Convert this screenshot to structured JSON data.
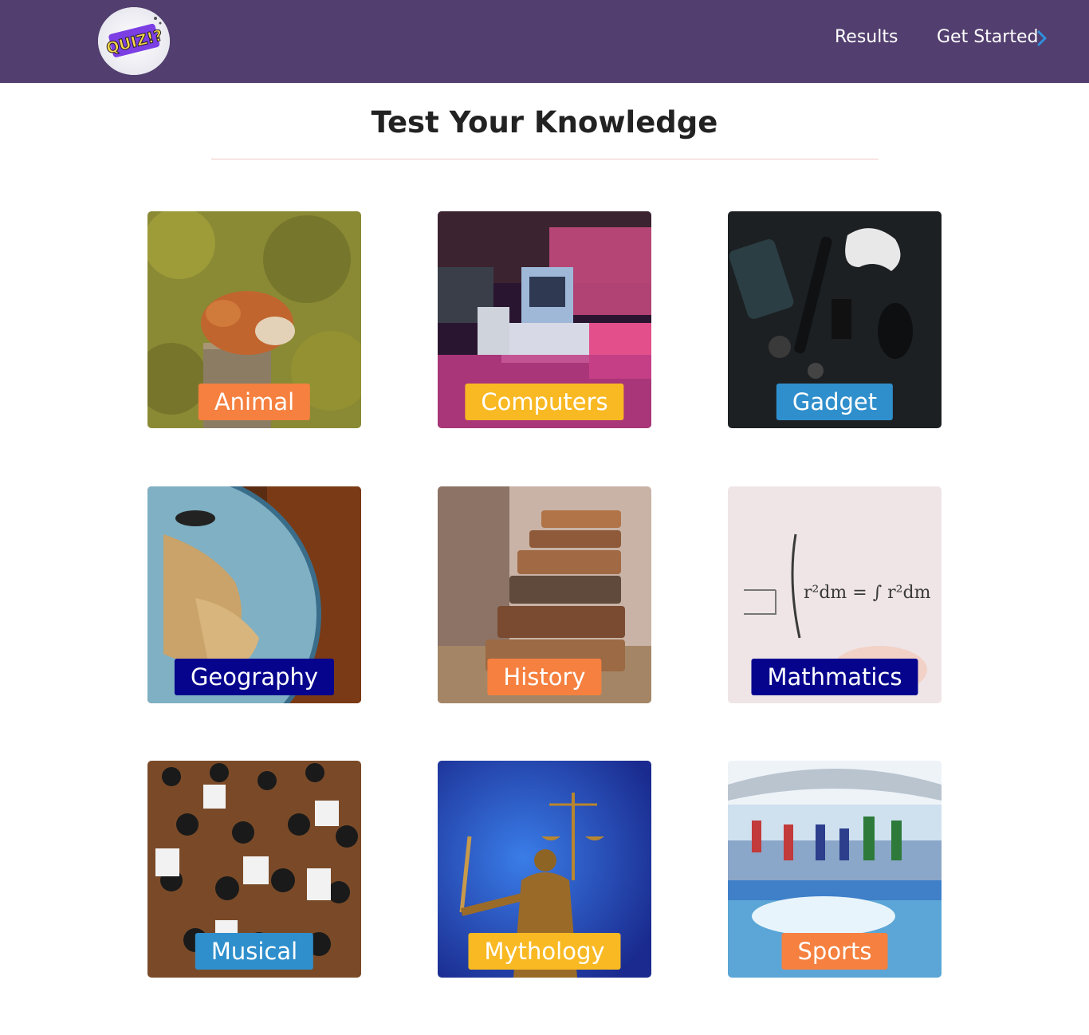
{
  "nav": {
    "logo_text": "QUIZ!?",
    "links": [
      "Results",
      "Get Started"
    ]
  },
  "page": {
    "title": "Test Your Knowledge"
  },
  "categories": [
    {
      "label": "Animal",
      "color": "#f5803f"
    },
    {
      "label": "Computers",
      "color": "#f9b923"
    },
    {
      "label": "Gadget",
      "color": "#2f8fcc"
    },
    {
      "label": "Geography",
      "color": "#06048d"
    },
    {
      "label": "History",
      "color": "#f5803f"
    },
    {
      "label": "Mathmatics",
      "color": "#06048d"
    },
    {
      "label": "Musical",
      "color": "#2f8fcc"
    },
    {
      "label": "Mythology",
      "color": "#f9b923"
    },
    {
      "label": "Sports",
      "color": "#f5803f"
    }
  ]
}
